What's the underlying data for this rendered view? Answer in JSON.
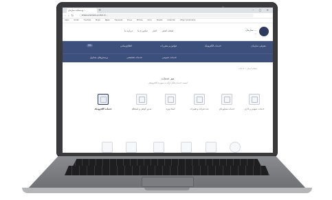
{
  "browser": {
    "tab_title": "وب‌سایت سازمان ...",
    "new_tab": "+",
    "window_controls": "– ▢ ✕",
    "nav_buttons": "‹ › ↻",
    "url": "www.example-portal.ir/...",
    "bookmarks": [
      "Apps",
      "Gmail",
      "YouTube",
      "Maps",
      "News",
      "Translate",
      "Drive",
      "Photos",
      "Docs",
      "Sheets",
      "Calendar",
      "Other bookmarks"
    ]
  },
  "site": {
    "logo_text_line1": "سازمان ...",
    "logo_text_line2": "...",
    "top_links": [
      "صفحه اصلی",
      "اخبار",
      "تماس با ما",
      "درباره ما"
    ],
    "lang_pill": "EN",
    "main_nav": [
      "معرفی سازمان",
      "خدمات الکترونیک",
      "قوانین و مقررات",
      "اطلاع‌رسانی"
    ],
    "main_nav_2": [
      "خدمات عمومی",
      "خدمات تخصصی",
      "پرسش‌های متداول"
    ],
    "breadcrumb": "صفحه اصلی / خدمات",
    "section_title": "میز خدمات",
    "section_subtitle": "لیست خدمات قابل ارائه به صورت الکترونیکی",
    "cards": [
      {
        "label": "خدمات عمومی و اداری"
      },
      {
        "label": "خدمات مشاوره‌ای"
      },
      {
        "label": "ثبت شرکت و تغییرات"
      },
      {
        "label": "اسناد ویژه"
      },
      {
        "label": "صدور گواهی و استعلام"
      },
      {
        "label": "خدمات الکترونیک"
      }
    ]
  },
  "colors": {
    "nav_bg": "#3d4f7b",
    "accent": "#2e3a5e"
  }
}
